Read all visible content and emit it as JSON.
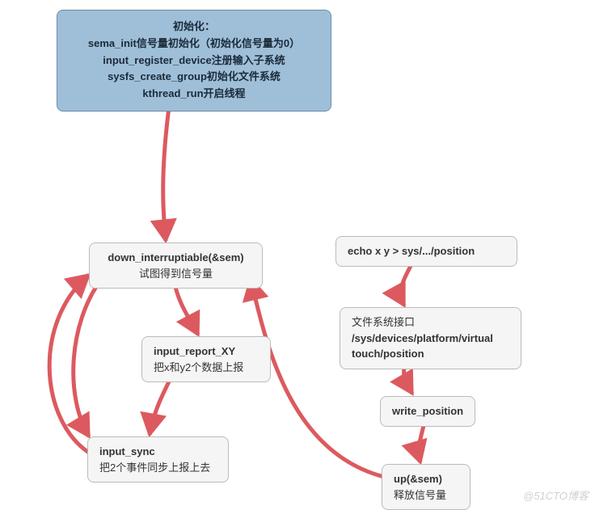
{
  "nodes": {
    "init": {
      "line1": "初始化：",
      "line2": "sema_init信号量初始化（初始化信号量为0）",
      "line3": "input_register_device注册输入子系统",
      "line4": "sysfs_create_group初始化文件系统",
      "line5": "kthread_run开启线程"
    },
    "down": {
      "title": "down_interruptiable(&sem)",
      "sub": "试图得到信号量"
    },
    "report": {
      "title": "input_report_XY",
      "sub": "把x和y2个数据上报"
    },
    "sync": {
      "title": "input_sync",
      "sub": "把2个事件同步上报上去"
    },
    "echo": {
      "title": "echo x y > sys/.../position"
    },
    "fsiface": {
      "title": "文件系统接口",
      "sub": "/sys/devices/platform/virtual touch/position"
    },
    "writepos": {
      "title": "write_position"
    },
    "up": {
      "title": "up(&sem)",
      "sub": "释放信号量"
    }
  },
  "watermark": "@51CTO博客",
  "arrow_color": "#dc5a5f"
}
